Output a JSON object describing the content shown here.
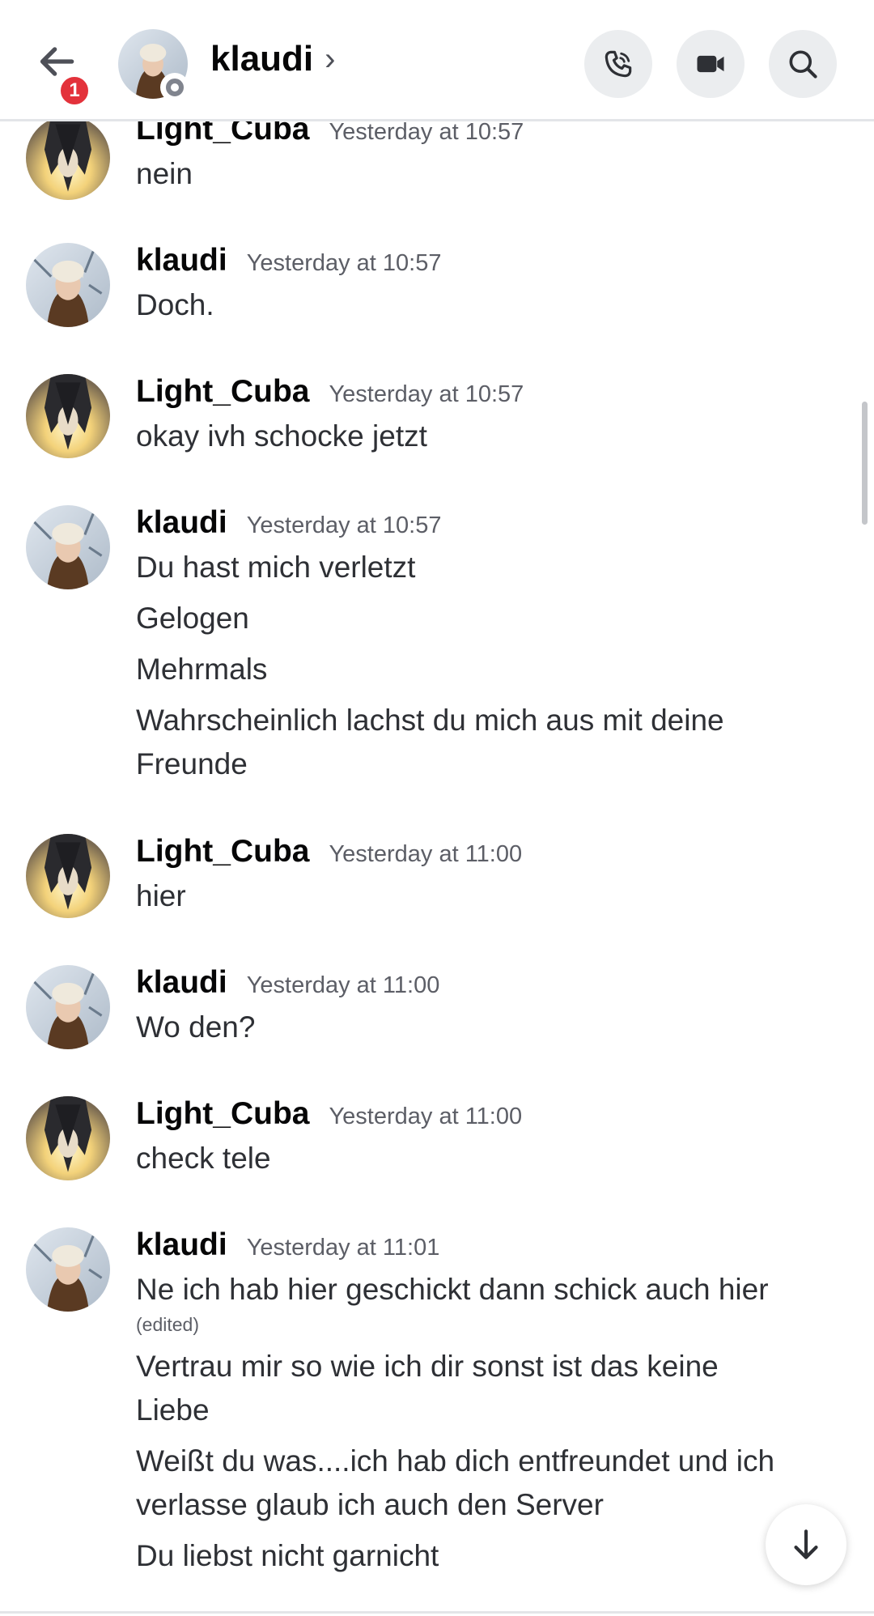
{
  "header": {
    "title": "klaudi",
    "unread_badge": "1",
    "chevron": "›",
    "icons": {
      "back": "arrow-left-icon",
      "call": "phone-call-icon",
      "video": "video-camera-icon",
      "search": "search-icon"
    }
  },
  "colors": {
    "badge": "#e3323b",
    "status_idle": "#80848e",
    "button_bg": "#ebedef"
  },
  "messages": [
    {
      "user": "Light_Cuba",
      "time": "Yesterday at 10:57",
      "lines": [
        "nein"
      ]
    },
    {
      "user": "klaudi",
      "time": "Yesterday at 10:57",
      "lines": [
        "Doch."
      ]
    },
    {
      "user": "Light_Cuba",
      "time": "Yesterday at 10:57",
      "lines": [
        "okay ivh schocke jetzt"
      ]
    },
    {
      "user": "klaudi",
      "time": "Yesterday at 10:57",
      "lines": [
        "Du hast mich verletzt",
        "Gelogen",
        "Mehrmals",
        "Wahrscheinlich lachst du mich aus mit deine",
        "Freunde"
      ]
    },
    {
      "user": "Light_Cuba",
      "time": "Yesterday at 11:00",
      "lines": [
        "hier"
      ]
    },
    {
      "user": "klaudi",
      "time": "Yesterday at 11:00",
      "lines": [
        "Wo den?"
      ]
    },
    {
      "user": "Light_Cuba",
      "time": "Yesterday at 11:00",
      "lines": [
        "check tele"
      ]
    },
    {
      "user": "klaudi",
      "time": "Yesterday at 11:01",
      "lines": [
        "Ne ich hab hier geschickt dann schick auch hier",
        "(edited)",
        "Vertrau mir so wie ich dir sonst ist das keine",
        "Liebe",
        "Weißt du was....ich hab dich entfreundet und ich",
        "verlasse glaub ich auch den Server",
        "Du liebst nicht garnicht"
      ]
    }
  ]
}
